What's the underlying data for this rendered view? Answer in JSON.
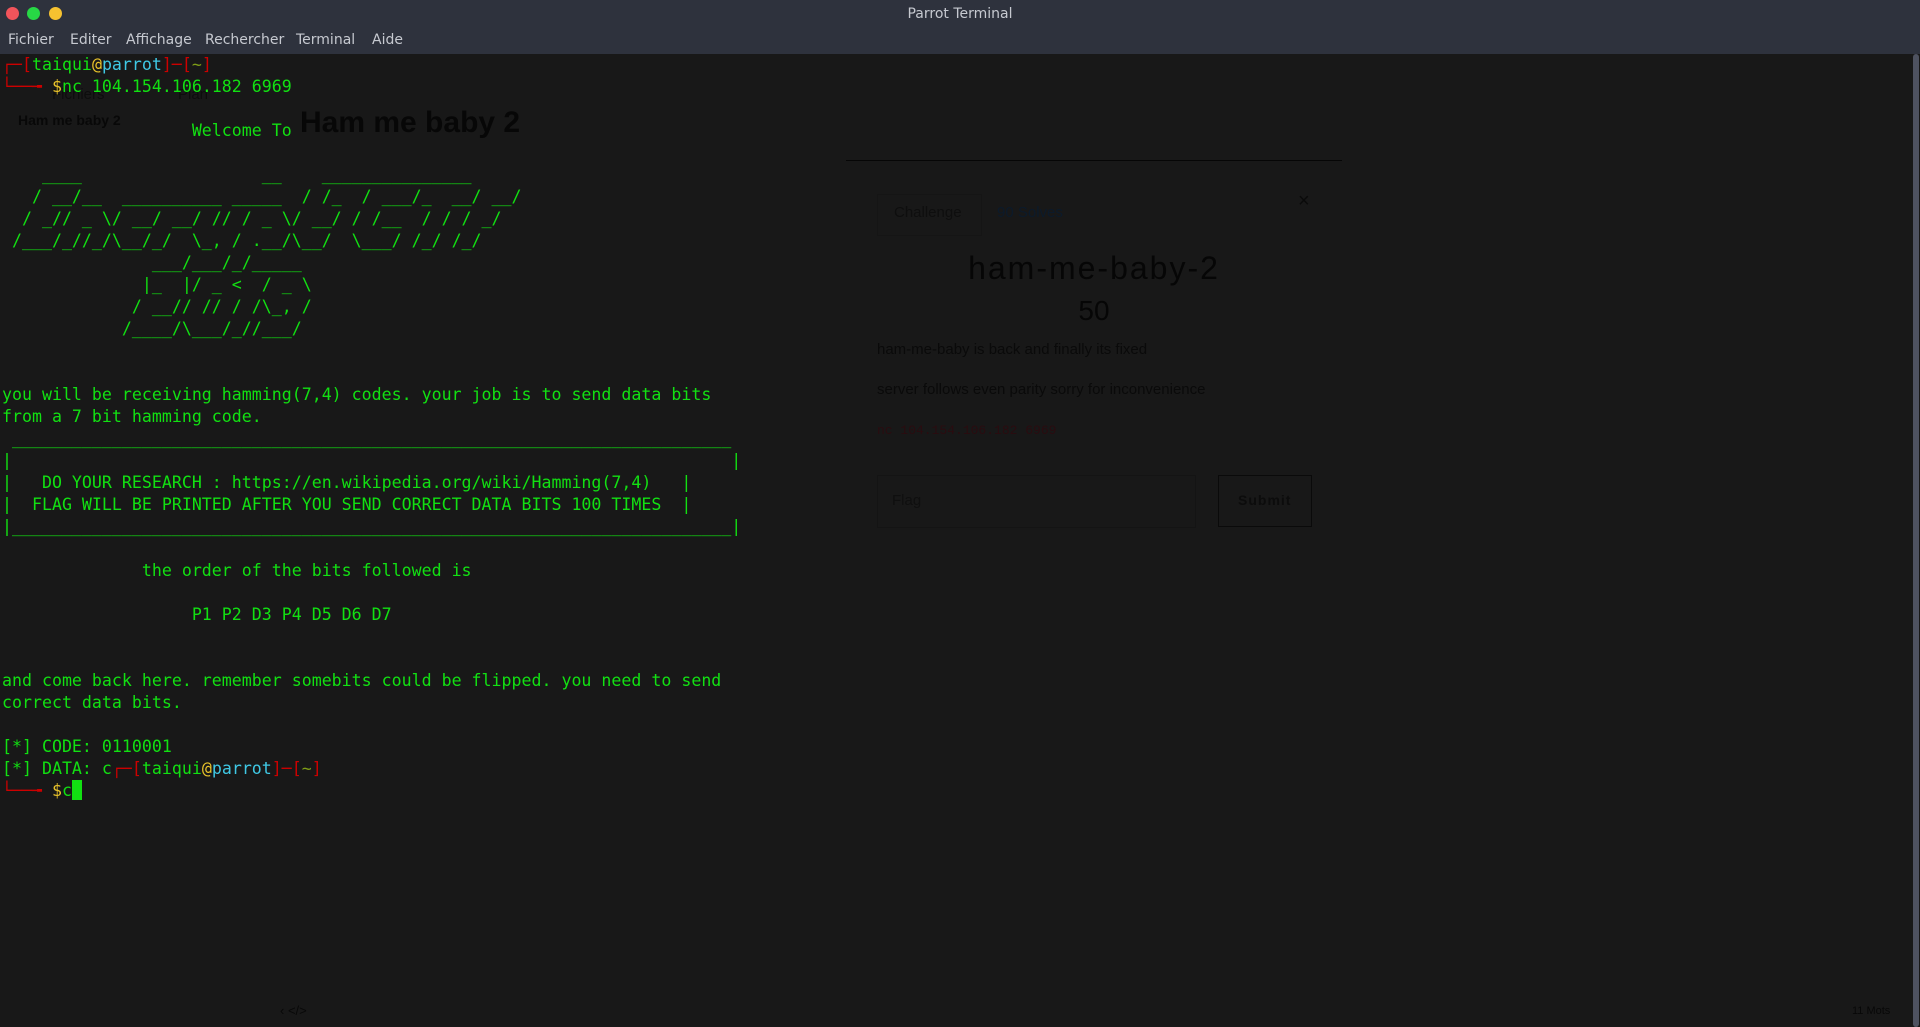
{
  "window": {
    "title": "Parrot Terminal"
  },
  "menu": [
    "Fichier",
    "Editer",
    "Affichage",
    "Rechercher",
    "Terminal",
    "Aide"
  ],
  "background_page": {
    "nav": [
      "Fichiers",
      "Plan"
    ],
    "sidebar_title": "Ham me baby 2",
    "heading": "Ham me baby 2",
    "modal": {
      "tab_challenge": "Challenge",
      "tab_solves": "90 Solves",
      "close": "×",
      "name": "ham-me-baby-2",
      "points": "50",
      "desc1": "ham-me-baby is back and finally its fixed",
      "desc2": "server follows even parity sorry for inconvenience",
      "connect": "nc 104.154.106.182 6969",
      "flag_placeholder": "Flag",
      "submit": "Submit"
    },
    "footer_left": "‹  </>",
    "footer_right": "11 Mots"
  },
  "prompt": {
    "corner_top": "┌─[",
    "user": "taiqui",
    "at": "@",
    "host": "parrot",
    "sep": "]─[",
    "dir": "~",
    "close": "]",
    "corner_bottom": "└──╼ ",
    "dollar": "$"
  },
  "terminal": {
    "command": "nc 104.154.106.182 6969",
    "welcome": "                   Welcome To",
    "ascii": [
      "    ____                  __    _______________",
      "   / __/__  __________ _____  / /_  / ___/_  __/ __/",
      "  / _// _ \\/ __/ __/ // / _ \\/ __/ / /__  / / / _/",
      " /___/_//_/\\__/_/  \\_, / .__/\\__/  \\___/ /_/ /_/",
      "               ___/___/_/_____",
      "              |_  |/ _ <  / _ \\",
      "             / __// // / /\\_, /",
      "            /____/\\___/_//___/"
    ],
    "intro1": "you will be receiving hamming(7,4) codes. your job is to send data bits",
    "intro2": "from a 7 bit hamming code.",
    "box": [
      " ________________________________________________________________________",
      "|                                                                        |",
      "|   DO YOUR RESEARCH : https://en.wikipedia.org/wiki/Hamming(7,4)   |",
      "|  FLAG WILL BE PRINTED AFTER YOU SEND CORRECT DATA BITS 100 TIMES  |",
      "|________________________________________________________________________|"
    ],
    "order": "              the order of the bits followed is",
    "bits": "                   P1 P2 D3 P4 D5 D6 D7",
    "remember1": "and come back here. remember somebits could be flipped. you need to send",
    "remember2": "correct data bits.",
    "code": "[*] CODE: 0110001",
    "data": "[*] DATA: c",
    "input": "c"
  }
}
